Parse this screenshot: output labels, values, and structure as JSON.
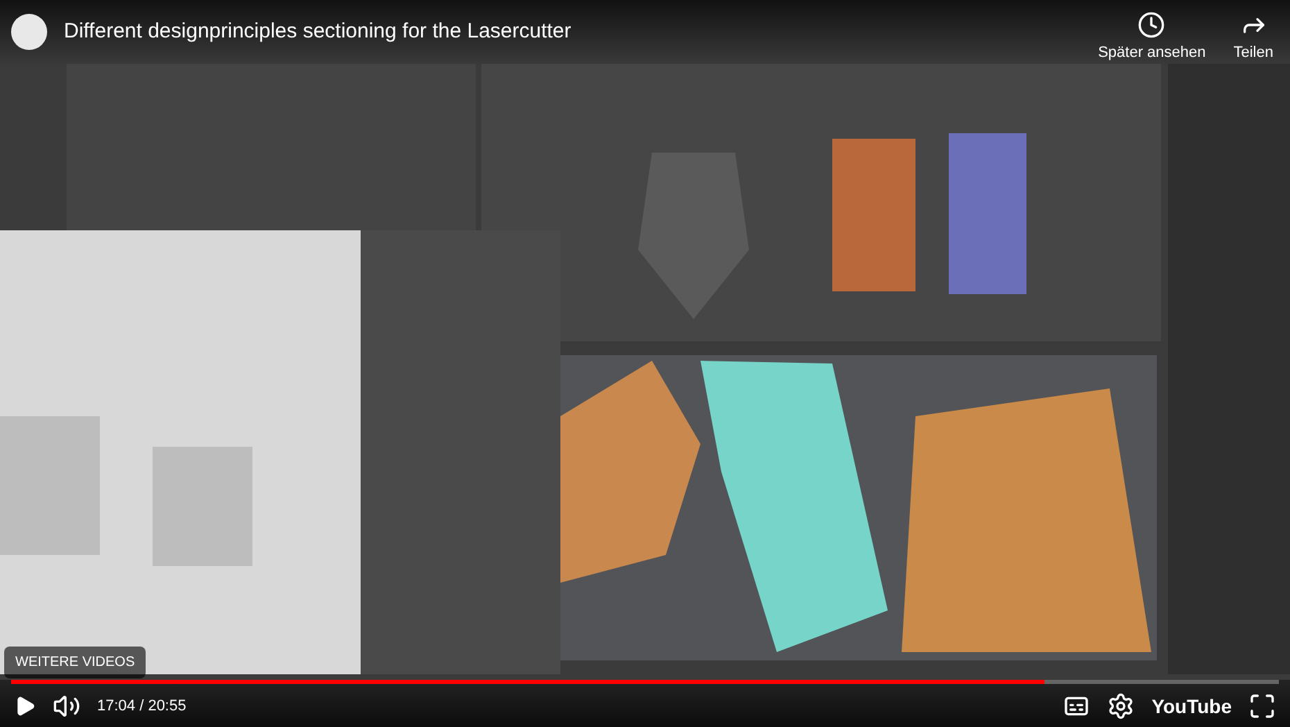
{
  "header": {
    "title": "Different designprinciples sectioning for the Lasercutter",
    "actions": [
      {
        "kind": "watch_later",
        "label": "Später ansehen"
      },
      {
        "kind": "share",
        "label": "Teilen"
      }
    ]
  },
  "more_videos": {
    "label": "WEITERE VIDEOS"
  },
  "player": {
    "progress": {
      "level": 0.815
    },
    "time": "17:04 / 20:55",
    "logo": "YouTube"
  }
}
